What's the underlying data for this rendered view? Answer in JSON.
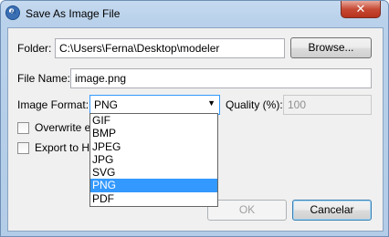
{
  "window": {
    "title": "Save As Image File",
    "close_glyph": "✕",
    "app_icon_text": "AI"
  },
  "folder": {
    "label": "Folder:",
    "value": "C:\\Users\\Ferna\\Desktop\\modeler",
    "browse_label": "Browse..."
  },
  "file_name": {
    "label": "File Name:",
    "value": "image.png"
  },
  "image_format": {
    "label": "Image Format:",
    "selected": "PNG",
    "arrow_glyph": "▼",
    "options": [
      "GIF",
      "BMP",
      "JPEG",
      "JPG",
      "SVG",
      "PNG",
      "PDF"
    ],
    "selected_index": 5
  },
  "quality": {
    "label": "Quality (%):",
    "value": "100"
  },
  "overwrite": {
    "label": "Overwrite ex"
  },
  "export_html": {
    "label": "Export to HT"
  },
  "buttons": {
    "ok": "OK",
    "cancel": "Cancelar"
  },
  "colors": {
    "selection": "#3399ff",
    "title_bar": "#b9d1ea",
    "close_button": "#c74a35"
  }
}
